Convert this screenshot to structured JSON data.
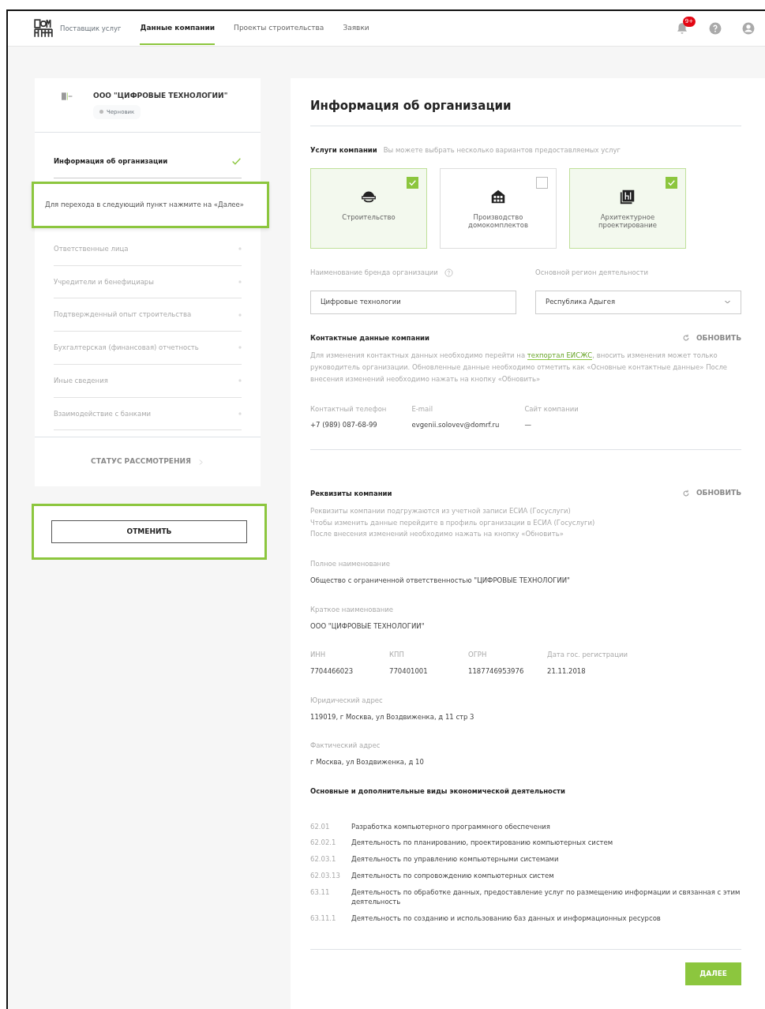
{
  "header": {
    "brand": "Поставщик услуг",
    "nav": [
      {
        "label": "Данные компании",
        "selected": true
      },
      {
        "label": "Проекты строительства",
        "selected": false
      },
      {
        "label": "Заявки",
        "selected": false
      }
    ],
    "notification_badge": "9+"
  },
  "sidebar": {
    "company_name": "ООО \"ЦИФРОВЫЕ ТЕХНОЛОГИИ\"",
    "status": "Черновик",
    "items": [
      {
        "label": "Информация об организации",
        "selected": true,
        "completed": true
      },
      {
        "label": "Ответственные лица",
        "selected": false,
        "completed": false
      },
      {
        "label": "Учредители и бенефициары",
        "selected": false,
        "completed": false
      },
      {
        "label": "Подтвержденный опыт строительства",
        "selected": false,
        "completed": false
      },
      {
        "label": "Бухгалтерская (финансовая) отчетность",
        "selected": false,
        "completed": false
      },
      {
        "label": "Иные сведения",
        "selected": false,
        "completed": false
      },
      {
        "label": "Взаимодействие с банками",
        "selected": false,
        "completed": false
      }
    ],
    "tooltip": "Для перехода в следующий пункт нажмите на «Далее»",
    "status_button": "СТАТУС РАССМОТРЕНИЯ",
    "cancel_button": "ОТМЕНИТЬ"
  },
  "main": {
    "title": "Информация об организации",
    "services": {
      "label": "Услуги компании",
      "hint": "Вы можете выбрать несколько вариантов предоставляемых услуг",
      "options": [
        {
          "kind": "helmet",
          "label": "Строительство",
          "checked": true
        },
        {
          "kind": "factory",
          "label": "Производство домокомплектов",
          "checked": false
        },
        {
          "kind": "blueprint",
          "label": "Архитектурное проектирование",
          "checked": true
        }
      ]
    },
    "brand_field": {
      "label": "Наименование бренда организации",
      "value": "Цифровые технологии"
    },
    "region_field": {
      "label": "Основной регион деятельности",
      "value": "Республика Адыгея"
    },
    "contacts": {
      "title": "Контактные данные компании",
      "refresh": "ОБНОВИТЬ",
      "text_before": "Для изменения контактных данных необходимо перейти на",
      "link": "техпортал ЕИСЖС",
      "text_after": ", вносить изменения может только руководитель организации. Обновленные данные необходимо отметить как «Основные контактные данные» После внесения изменений необходимо нажать на кнопку «Обновить»",
      "fields": [
        {
          "label": "Контактный телефон",
          "value": "+7 (989) 087-68-99"
        },
        {
          "label": "E-mail",
          "value": "evgenii.solovev@domrf.ru"
        },
        {
          "label": "Сайт компании",
          "value": "—"
        }
      ]
    },
    "requisites": {
      "title": "Реквизиты компании",
      "refresh": "ОБНОВИТЬ",
      "lines": [
        "Реквизиты компании подгружаются из учетной записи ЕСИА (Госуслуги)",
        "Чтобы изменить данные перейдите в профиль организации в ЕСИА (Госуслуги)",
        "После внесения изменений необходимо нажать на кнопку «Обновить»"
      ],
      "rows": [
        [
          {
            "label": "Полное наименование",
            "value": "Общество с ограниченной ответственностью \"ЦИФРОВЫЕ ТЕХНОЛОГИИ\""
          }
        ],
        [
          {
            "label": "Краткое наименование",
            "value": "ООО \"ЦИФРОВЫЕ ТЕХНОЛОГИИ\""
          }
        ],
        [
          {
            "label": "ИНН",
            "value": "7704466023"
          },
          {
            "label": "КПП",
            "value": "770401001"
          },
          {
            "label": "ОГРН",
            "value": "1187746953976"
          },
          {
            "label": "Дата гос. регистрации",
            "value": "21.11.2018"
          }
        ],
        [
          {
            "label": "Юридический адрес",
            "value": "119019, г Москва, ул Воздвиженка, д 11 стр 3"
          }
        ],
        [
          {
            "label": "Фактический адрес",
            "value": "г Москва, ул Воздвиженка, д 10"
          }
        ]
      ]
    },
    "activities": {
      "title": "Основные и дополнительные виды экономической деятельности",
      "items": [
        {
          "code": "62.01",
          "name": "Разработка компьютерного программного обеспечения"
        },
        {
          "code": "62.02.1",
          "name": "Деятельность по планированию, проектированию компьютерных систем"
        },
        {
          "code": "62.03.1",
          "name": "Деятельность по управлению компьютерными системами"
        },
        {
          "code": "62.03.13",
          "name": "Деятельность по сопровождению компьютерных систем"
        },
        {
          "code": "63.11",
          "name": "Деятельность по обработке данных, предоставление услуг по размещению информации и связанная с этим деятельность"
        },
        {
          "code": "63.11.1",
          "name": "Деятельность по созданию и использованию баз данных и информационных ресурсов"
        }
      ]
    },
    "next_button": "ДАЛЕЕ"
  }
}
